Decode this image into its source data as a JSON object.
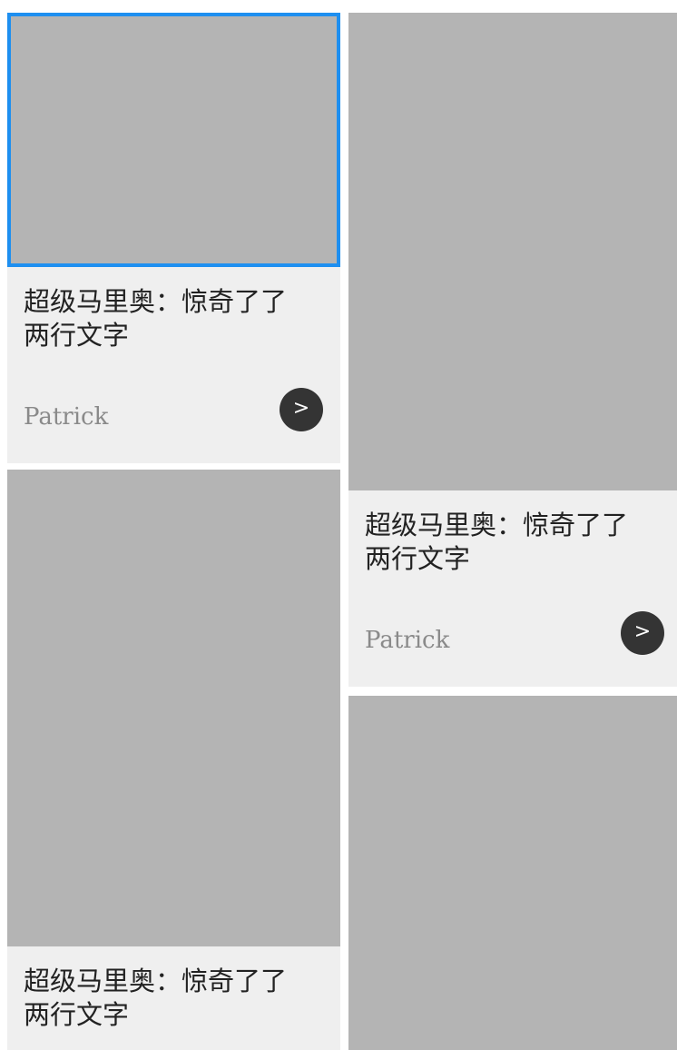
{
  "colors": {
    "selection_border": "#1e8ff0",
    "image_placeholder": "#b4b4b4",
    "card_background": "#efefef",
    "button_background": "#343434"
  },
  "cards": [
    {
      "title": "超级马里奥：惊奇了了\n两行文字",
      "author": "Patrick",
      "button_label": ">",
      "button_icon": "chevron-right-icon",
      "selected": true
    },
    {
      "title": "超级马里奥：惊奇了了\n两行文字",
      "author": "Patrick",
      "button_label": ">",
      "button_icon": "chevron-right-icon",
      "selected": false
    },
    {
      "title": "超级马里奥：惊奇了了\n两行文字",
      "selected": false
    },
    {
      "selected": false
    }
  ]
}
